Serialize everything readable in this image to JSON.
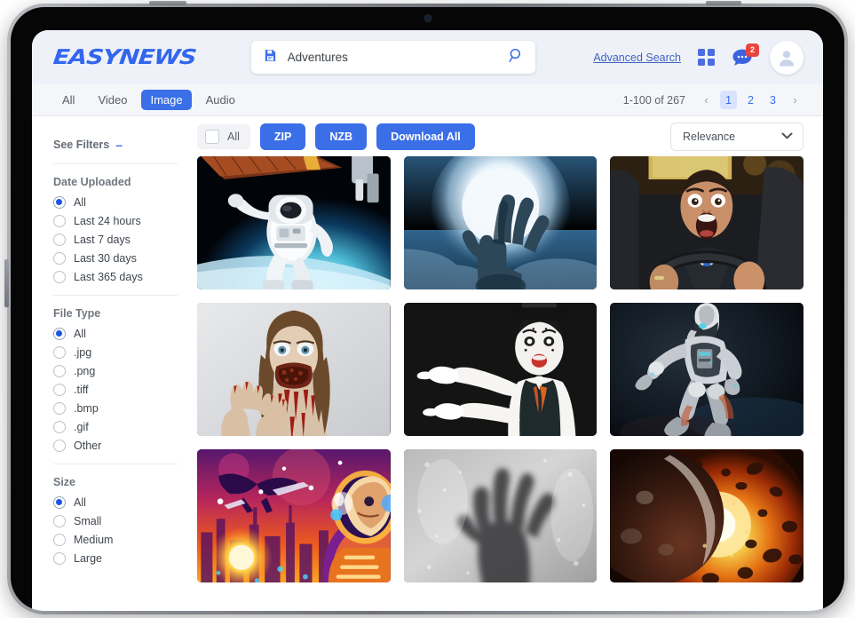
{
  "brand": {
    "logo_text": "EASYNEWS",
    "accent": "#3b6fe8",
    "logo_color": "#3366ee"
  },
  "header": {
    "search": {
      "value": "Adventures",
      "placeholder": "Search",
      "save_icon": "floppy-disk-icon",
      "submit_icon": "search-icon"
    },
    "advanced_search_label": "Advanced Search",
    "grid_icon": "grid-view-icon",
    "chat_icon": "chat-bubble-icon",
    "chat_badge": "2",
    "avatar_icon": "user-avatar-icon"
  },
  "tabs": [
    {
      "label": "All",
      "active": false
    },
    {
      "label": "Video",
      "active": false
    },
    {
      "label": "Image",
      "active": true
    },
    {
      "label": "Audio",
      "active": false
    }
  ],
  "pagination": {
    "range_label": "1-100 of 267",
    "prev": "‹",
    "next": "›",
    "pages": [
      {
        "label": "1",
        "active": true
      },
      {
        "label": "2",
        "active": false
      },
      {
        "label": "3",
        "active": false
      }
    ]
  },
  "sidebar": {
    "see_filters_label": "See Filters",
    "collapse_glyph": "–",
    "groups": [
      {
        "title": "Date Uploaded",
        "options": [
          {
            "label": "All",
            "selected": true
          },
          {
            "label": "Last 24 hours",
            "selected": false
          },
          {
            "label": "Last 7 days",
            "selected": false
          },
          {
            "label": "Last 30 days",
            "selected": false
          },
          {
            "label": "Last 365 days",
            "selected": false
          }
        ]
      },
      {
        "title": "File Type",
        "options": [
          {
            "label": "All",
            "selected": true
          },
          {
            "label": ".jpg",
            "selected": false
          },
          {
            "label": ".png",
            "selected": false
          },
          {
            "label": ".tiff",
            "selected": false
          },
          {
            "label": ".bmp",
            "selected": false
          },
          {
            "label": ".gif",
            "selected": false
          },
          {
            "label": "Other",
            "selected": false
          }
        ]
      },
      {
        "title": "Size",
        "options": [
          {
            "label": "All",
            "selected": true
          },
          {
            "label": "Small",
            "selected": false
          },
          {
            "label": "Medium",
            "selected": false
          },
          {
            "label": "Large",
            "selected": false
          }
        ]
      }
    ]
  },
  "toolbar": {
    "select_all_label": "All",
    "select_all_checked": false,
    "zip_label": "ZIP",
    "nzb_label": "NZB",
    "download_all_label": "Download All",
    "sort_value": "Relevance",
    "sort_chevron": "⌄"
  },
  "results": {
    "items": [
      {
        "name": "astronaut-spacewalk",
        "alt": "Astronaut floating in space above Earth"
      },
      {
        "name": "zombie-hand-moon",
        "alt": "Zombie hand rising in front of a full moon"
      },
      {
        "name": "screaming-driver",
        "alt": "Man in suit screaming while gripping a steering wheel"
      },
      {
        "name": "zombie-woman",
        "alt": "Woman in zombie makeup reaching forward"
      },
      {
        "name": "mime-performer",
        "alt": "Mime in bowler hat and white gloves gesturing"
      },
      {
        "name": "kneeling-robot",
        "alt": "Humanoid robot kneeling in dark blue light"
      },
      {
        "name": "retro-scifi-astronaut",
        "alt": "Neon retro sci-fi astronaut over a futuristic city"
      },
      {
        "name": "hand-frosted-glass",
        "alt": "Hand pressed against foggy wet glass in black and white"
      },
      {
        "name": "planet-explosion",
        "alt": "Planet with fiery orange explosion and debris"
      }
    ]
  }
}
